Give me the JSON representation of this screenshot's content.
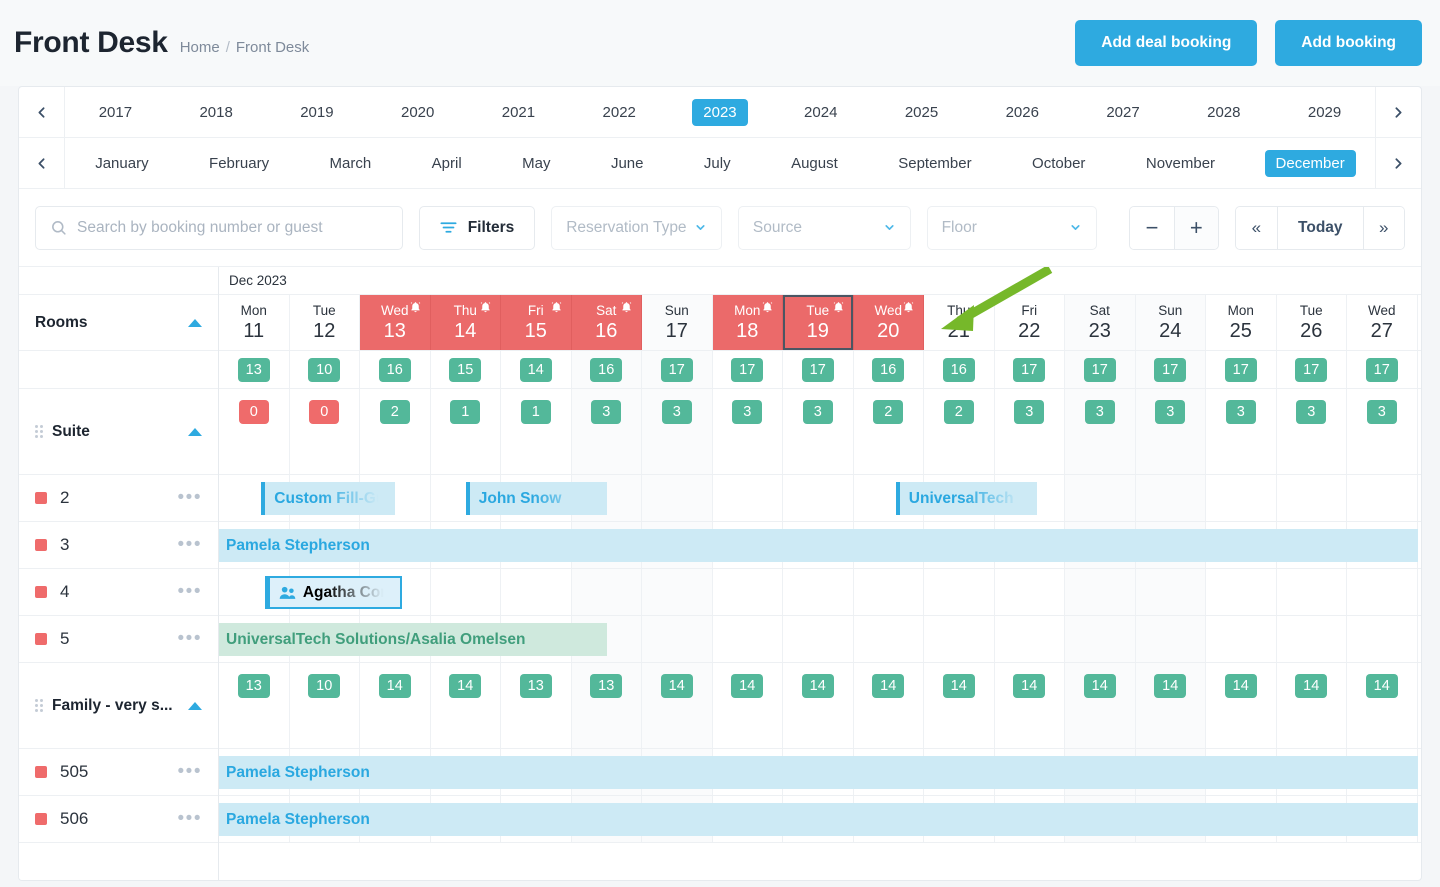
{
  "header": {
    "title": "Front Desk",
    "breadcrumb": {
      "home": "Home",
      "separator": "/",
      "current": "Front Desk"
    },
    "buttons": {
      "add_deal_booking": "Add deal booking",
      "add_booking": "Add booking"
    },
    "accent_color": "#2eaae0"
  },
  "year_selector": {
    "prev": "‹",
    "next": "›",
    "years": [
      "2017",
      "2018",
      "2019",
      "2020",
      "2021",
      "2022",
      "2023",
      "2024",
      "2025",
      "2026",
      "2027",
      "2028",
      "2029"
    ],
    "selected": "2023"
  },
  "month_selector": {
    "prev": "‹",
    "next": "›",
    "months": [
      "January",
      "February",
      "March",
      "April",
      "May",
      "June",
      "July",
      "August",
      "September",
      "October",
      "November",
      "December"
    ],
    "selected": "December"
  },
  "toolbar": {
    "search": {
      "placeholder": "Search by booking number or guest",
      "value": ""
    },
    "filters_label": "Filters",
    "dropdowns": [
      {
        "label": "Reservation Type"
      },
      {
        "label": "Source"
      },
      {
        "label": "Floor"
      }
    ],
    "zoom_out": "−",
    "zoom_in": "+",
    "prev_label": "«",
    "today_label": "Today",
    "next_label": "»"
  },
  "timeline": {
    "month_label": "Dec 2023",
    "rooms_header": "Rooms",
    "columns": [
      {
        "dow": "Mon",
        "day": "11",
        "closed": false,
        "weekend": false,
        "today": false,
        "avail": "13",
        "suite": "0",
        "family": "13"
      },
      {
        "dow": "Tue",
        "day": "12",
        "closed": false,
        "weekend": false,
        "today": false,
        "avail": "10",
        "suite": "0",
        "family": "10"
      },
      {
        "dow": "Wed",
        "day": "13",
        "closed": true,
        "weekend": false,
        "today": false,
        "avail": "16",
        "suite": "2",
        "family": "14"
      },
      {
        "dow": "Thu",
        "day": "14",
        "closed": true,
        "weekend": false,
        "today": false,
        "avail": "15",
        "suite": "1",
        "family": "14"
      },
      {
        "dow": "Fri",
        "day": "15",
        "closed": true,
        "weekend": false,
        "today": false,
        "avail": "14",
        "suite": "1",
        "family": "13"
      },
      {
        "dow": "Sat",
        "day": "16",
        "closed": true,
        "weekend": true,
        "today": false,
        "avail": "16",
        "suite": "3",
        "family": "13"
      },
      {
        "dow": "Sun",
        "day": "17",
        "closed": false,
        "weekend": true,
        "today": false,
        "avail": "17",
        "suite": "3",
        "family": "14"
      },
      {
        "dow": "Mon",
        "day": "18",
        "closed": true,
        "weekend": false,
        "today": false,
        "avail": "17",
        "suite": "3",
        "family": "14"
      },
      {
        "dow": "Tue",
        "day": "19",
        "closed": true,
        "weekend": false,
        "today": true,
        "avail": "17",
        "suite": "3",
        "family": "14"
      },
      {
        "dow": "Wed",
        "day": "20",
        "closed": true,
        "weekend": false,
        "today": false,
        "avail": "16",
        "suite": "2",
        "family": "14"
      },
      {
        "dow": "Thu",
        "day": "21",
        "closed": false,
        "weekend": false,
        "today": false,
        "avail": "16",
        "suite": "2",
        "family": "14"
      },
      {
        "dow": "Fri",
        "day": "22",
        "closed": false,
        "weekend": false,
        "today": false,
        "avail": "17",
        "suite": "3",
        "family": "14"
      },
      {
        "dow": "Sat",
        "day": "23",
        "closed": false,
        "weekend": true,
        "today": false,
        "avail": "17",
        "suite": "3",
        "family": "14"
      },
      {
        "dow": "Sun",
        "day": "24",
        "closed": false,
        "weekend": true,
        "today": false,
        "avail": "17",
        "suite": "3",
        "family": "14"
      },
      {
        "dow": "Mon",
        "day": "25",
        "closed": false,
        "weekend": false,
        "today": false,
        "avail": "17",
        "suite": "3",
        "family": "14"
      },
      {
        "dow": "Tue",
        "day": "26",
        "closed": false,
        "weekend": false,
        "today": false,
        "avail": "17",
        "suite": "3",
        "family": "14"
      },
      {
        "dow": "Wed",
        "day": "27",
        "closed": false,
        "weekend": false,
        "today": false,
        "avail": "17",
        "suite": "3",
        "family": "14"
      }
    ],
    "groups": [
      {
        "name": "Suite",
        "rooms": [
          {
            "number": "2",
            "status_color": "#ef6b6b"
          },
          {
            "number": "3",
            "status_color": "#ef6b6b"
          },
          {
            "number": "4",
            "status_color": "#ef6b6b"
          },
          {
            "number": "5",
            "status_color": "#ef6b6b"
          }
        ]
      },
      {
        "name": "Family - very s...",
        "rooms": [
          {
            "number": "505",
            "status_color": "#ef6b6b"
          },
          {
            "number": "506",
            "status_color": "#ef6b6b"
          }
        ]
      }
    ],
    "bookings": [
      {
        "label": "Custom Fill-Gu",
        "row": 0,
        "start": 0.6,
        "span": 1.9,
        "style": "blue",
        "icon": null
      },
      {
        "label": "John Snow",
        "row": 0,
        "start": 3.5,
        "span": 2.0,
        "style": "blue",
        "icon": null
      },
      {
        "label": "UniversalTech",
        "row": 0,
        "start": 9.6,
        "span": 2.0,
        "style": "blue",
        "icon": null
      },
      {
        "label": "Pamela Stepherson",
        "row": 1,
        "start": 0.0,
        "span": 17.0,
        "style": "blue full",
        "icon": null
      },
      {
        "label": "Agatha Confer",
        "row": 2,
        "start": 0.65,
        "span": 1.95,
        "style": "outlined",
        "icon": "group-icon"
      },
      {
        "label": "UniversalTech Solutions/Asalia Omelsen",
        "row": 3,
        "start": 0.0,
        "span": 5.5,
        "style": "green",
        "icon": null
      }
    ],
    "bookings2": [
      {
        "label": "Pamela Stepherson",
        "row": 0,
        "start": 0.0,
        "span": 17.0,
        "style": "blue full"
      },
      {
        "label": "Pamela Stepherson",
        "row": 1,
        "start": 0.0,
        "span": 17.0,
        "style": "blue full"
      }
    ],
    "colors": {
      "closed_day": "#eb6a6a",
      "badge_ok": "#53b89a",
      "badge_zero": "#ef6b6b",
      "booking_blue": "#cdeaf5",
      "booking_green": "#cfe9dd"
    }
  },
  "annotation": {
    "arrow_color": "#76b82a",
    "points_to": "Wed 20 alert bell"
  }
}
